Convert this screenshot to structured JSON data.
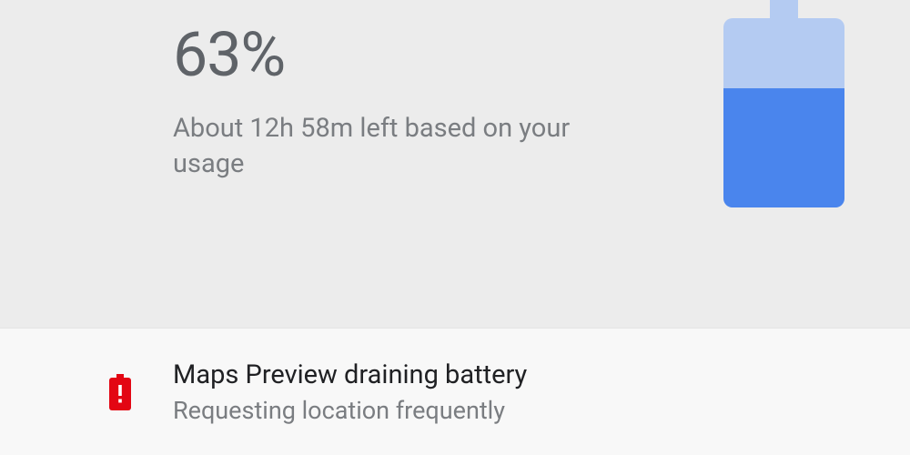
{
  "battery": {
    "percentage_label": "63%",
    "estimate_label": "About 12h 58m left based on your usage",
    "fill_fraction": 0.63,
    "colors": {
      "empty": "#b4cbf2",
      "fill": "#4a85ed"
    }
  },
  "alert": {
    "title": "Maps Preview draining battery",
    "subtitle": "Requesting location frequently",
    "icon_color": "#e30613"
  }
}
